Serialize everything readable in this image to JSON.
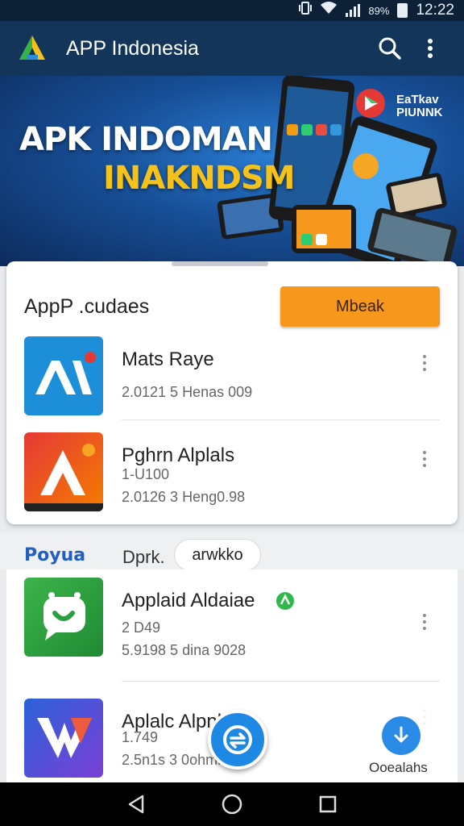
{
  "status_bar": {
    "icons": [
      "vibrate-icon",
      "wifi-icon",
      "signal-icon",
      "battery-icon"
    ],
    "battery": "89%",
    "time": "12:22"
  },
  "app_bar": {
    "title": "APP Indonesia",
    "icons": [
      "app-logo-icon",
      "search-icon",
      "more-vert-icon"
    ]
  },
  "banner": {
    "title": "APK INDOMAN",
    "subtitle": "INAKNDSM",
    "badge_line1": "EaTkav",
    "badge_line2": "PIUNNK"
  },
  "updates": {
    "title": "AppP .cudaes",
    "button_label": "Mbeak",
    "items": [
      {
        "name": "Mats Raye",
        "meta": "2.0121 5 Henas 009",
        "icon": "a-logo-blue-icon"
      },
      {
        "name": "Pghrn Alplals",
        "meta1": "1-U100",
        "meta2": "2.0126 3 Heng0.98",
        "icon": "a-logo-red-icon"
      }
    ]
  },
  "filter": {
    "brand": "Poyua",
    "text": "Dprk.",
    "chip": "arwkko"
  },
  "more_apps": {
    "items": [
      {
        "name": "Applaid Aldaiae",
        "meta1": "2 D49",
        "meta2": "5.9198 5 dina 9028",
        "icon": "chat-bubble-icon"
      },
      {
        "name": "Aplalc Alpnlsla",
        "meta1": "1.749",
        "meta2": "2.5n1s 3 0ohmn",
        "icon": "m-logo-icon"
      }
    ]
  },
  "downloads": {
    "label": "Ooealahs"
  },
  "nav_bar": {
    "buttons": [
      "back-icon",
      "home-icon",
      "recents-icon"
    ]
  },
  "colors": {
    "app_bar": "#123559",
    "status_bar": "#0d2136",
    "accent_orange": "#f5981c",
    "accent_blue": "#1e88e5",
    "banner_yellow": "#f4c21a"
  }
}
